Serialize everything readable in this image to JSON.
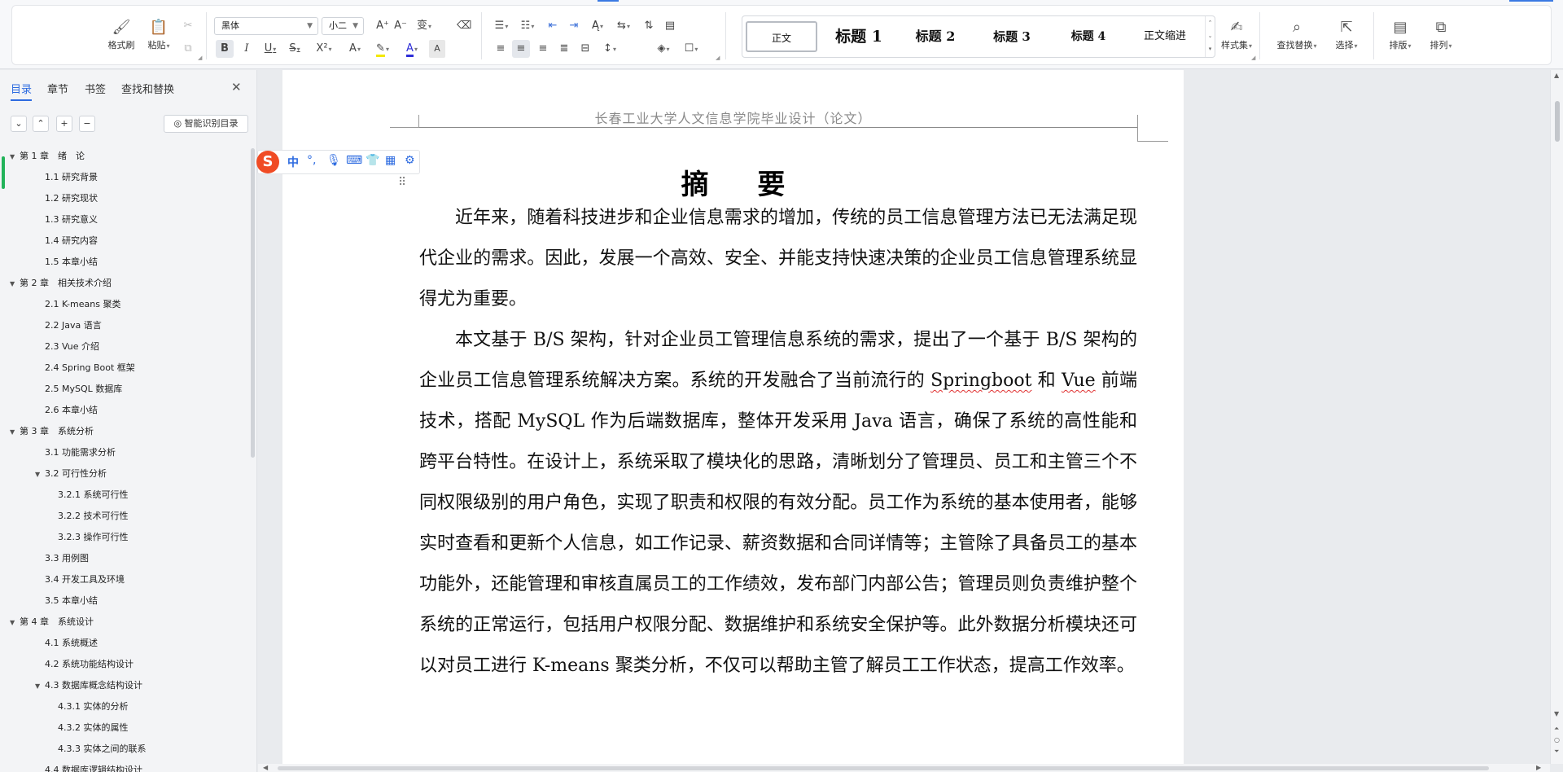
{
  "ribbon": {
    "format_painter": "格式刷",
    "paste": "粘贴",
    "font_name": "黑体",
    "font_size": "小二",
    "styles": [
      "正文",
      "标题 1",
      "标题 2",
      "标题 3",
      "标题 4",
      "正文缩进"
    ],
    "style_set": "样式集",
    "find_replace": "查找替换",
    "select": "选择",
    "layout": "排版",
    "arrange": "排列",
    "format_buttons": [
      "B",
      "I",
      "U",
      "S",
      "X²",
      "A",
      "A",
      "A"
    ]
  },
  "nav": {
    "tabs": [
      "目录",
      "章节",
      "书签",
      "查找和替换"
    ],
    "smart_toc": "智能识别目录",
    "toc": [
      {
        "label": "第 1 章　绪　论",
        "level": 1,
        "expanded": true
      },
      {
        "label": "1.1  研究背景",
        "level": 2
      },
      {
        "label": "1.2  研究现状",
        "level": 2
      },
      {
        "label": "1.3  研究意义",
        "level": 2
      },
      {
        "label": "1.4  研究内容",
        "level": 2
      },
      {
        "label": "1.5  本章小结",
        "level": 2
      },
      {
        "label": "第 2 章　相关技术介绍",
        "level": 1,
        "expanded": true
      },
      {
        "label": "2.1 K-means 聚类",
        "level": 2
      },
      {
        "label": "2.2 Java 语言",
        "level": 2
      },
      {
        "label": "2.3 Vue 介绍",
        "level": 2
      },
      {
        "label": "2.4 Spring Boot 框架",
        "level": 2
      },
      {
        "label": "2.5 MySQL 数据库",
        "level": 2
      },
      {
        "label": "2.6  本章小结",
        "level": 2
      },
      {
        "label": "第 3 章　系统分析",
        "level": 1,
        "expanded": true
      },
      {
        "label": "3.1  功能需求分析",
        "level": 2
      },
      {
        "label": "3.2  可行性分析",
        "level": 2,
        "expanded": true
      },
      {
        "label": "3.2.1  系统可行性",
        "level": 3
      },
      {
        "label": "3.2.2  技术可行性",
        "level": 3
      },
      {
        "label": "3.2.3  操作可行性",
        "level": 3
      },
      {
        "label": "3.3  用例图",
        "level": 2
      },
      {
        "label": "3.4  开发工具及环境",
        "level": 2
      },
      {
        "label": "3.5  本章小结",
        "level": 2
      },
      {
        "label": "第 4 章　系统设计",
        "level": 1,
        "expanded": true
      },
      {
        "label": "4.1  系统概述",
        "level": 2
      },
      {
        "label": "4.2  系统功能结构设计",
        "level": 2
      },
      {
        "label": "4.3  数据库概念结构设计",
        "level": 2,
        "expanded": true
      },
      {
        "label": "4.3.1  实体的分析",
        "level": 3
      },
      {
        "label": "4.3.2  实体的属性",
        "level": 3
      },
      {
        "label": "4.3.3  实体之间的联系",
        "level": 3
      },
      {
        "label": "4.4  数据库逻辑结构设计",
        "level": 2
      }
    ]
  },
  "ime": {
    "mode": "中"
  },
  "document": {
    "header": "长春工业大学人文信息学院毕业设计（论文）",
    "title": "摘  要",
    "p1": "近年来，随着科技进步和企业信息需求的增加，传统的员工信息管理方法已无法满足现代企业的需求。因此，发展一个高效、安全、并能支持快速决策的企业员工信息管理系统显得尤为重要。",
    "p2_a": "本文基于 B/S 架构，针对企业员工管理信息系统的需求，提出了一个基于 B/S 架构的企业员工信息管理系统解决方案。系统的开发融合了当前流行的 ",
    "p2_springboot": "Springboot",
    "p2_b": " 和 ",
    "p2_vue": "Vue",
    "p2_c": " 前端技术，搭配 MySQL 作为后端数据库，整体开发采用 Java 语言，确保了系统的高性能和跨平台特性。在设计上，系统采取了模块化的思路，清晰划分了管理员、员工和主管三个不同权限级别的用户角色，实现了职责和权限的有效分配。员工作为系统的基本使用者，能够实时查看和更新个人信息，如工作记录、薪资数据和合同详情等；主管除了具备员工的基本功能外，还能管理和审核直属员工的工作绩效，发布部门内部公告；管理员则负责维护整个系统的正常运行，包括用户权限分配、数据维护和系统安全保护等。此外数据分析模块还可以对员工进行 K-means 聚类分析，不仅可以帮助主管了解员工工作状态，提高工作效率。"
  },
  "colors": {
    "accent": "#2d6be0",
    "ime_logo": "#f04b24",
    "spell_error": "#e03030"
  }
}
